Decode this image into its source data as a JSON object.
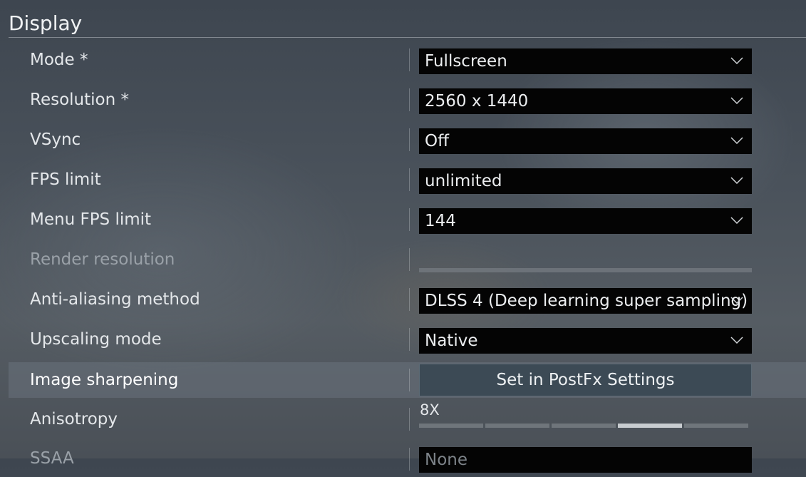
{
  "header": {
    "title": "Display"
  },
  "rows": [
    {
      "label": "Mode *",
      "value": "Fullscreen"
    },
    {
      "label": "Resolution *",
      "value": "2560 x 1440"
    },
    {
      "label": "VSync",
      "value": "Off"
    },
    {
      "label": "FPS limit",
      "value": "unlimited"
    },
    {
      "label": "Menu FPS limit",
      "value": "144"
    },
    {
      "label": "Render resolution",
      "value": ""
    },
    {
      "label": "Anti-aliasing method",
      "value": "DLSS 4 (Deep learning super sampling)"
    },
    {
      "label": "Upscaling mode",
      "value": "Native"
    },
    {
      "label": "Image sharpening",
      "button": "Set in PostFx Settings"
    },
    {
      "label": "Anisotropy",
      "value": "8X",
      "slider": {
        "steps": 5,
        "selected_index": 3
      }
    },
    {
      "label": "SSAA",
      "value": "None"
    }
  ],
  "colors": {
    "dropdown_bg": "#040404",
    "button_bg": "#3c4a55",
    "highlight_row": "#6e7882",
    "slider_active": "#c8ccd0",
    "slider_inactive": "#6f757b"
  }
}
